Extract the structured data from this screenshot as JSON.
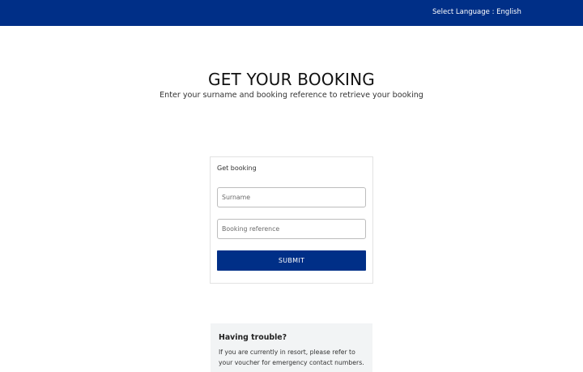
{
  "header": {
    "language_label": "Select Language : English"
  },
  "main": {
    "title": "GET YOUR BOOKING",
    "subtitle": "Enter your surname and booking reference to retrieve your booking"
  },
  "form": {
    "title": "Get booking",
    "surname_placeholder": "Surname",
    "surname_value": "",
    "reference_placeholder": "Booking reference",
    "reference_value": "",
    "submit_label": "SUBMIT"
  },
  "help": {
    "title": "Having trouble?",
    "text": "If you are currently in resort, please refer to your voucher for emergency contact numbers."
  },
  "colors": {
    "brand": "#002f87",
    "help_background": "#f2f4f5"
  }
}
